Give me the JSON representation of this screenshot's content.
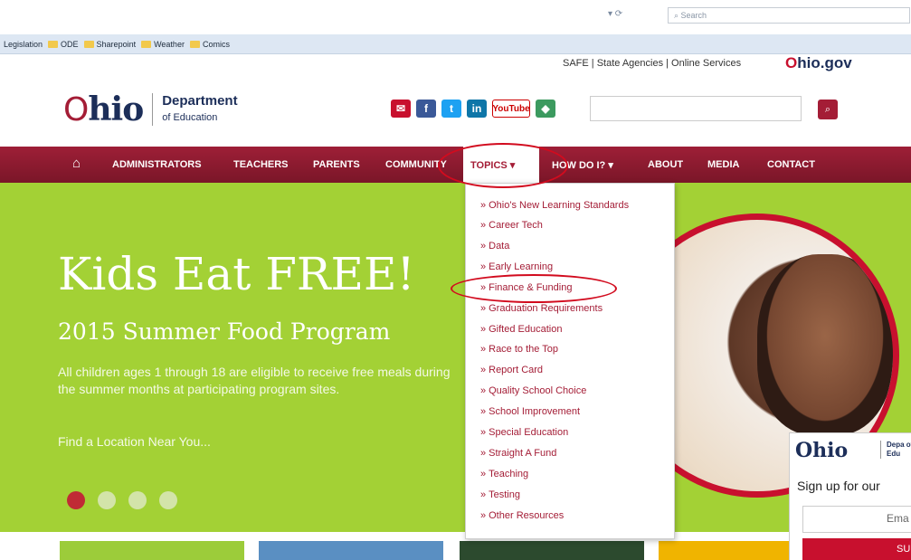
{
  "browser": {
    "refresh_icon": "refresh-icon",
    "search_placeholder": "Search",
    "bookmarks": [
      "Legislation",
      "ODE",
      "Sharepoint",
      "Weather",
      "Comics"
    ]
  },
  "header": {
    "util_links": "SAFE | State Agencies | Online Services",
    "ohio_gov_prefix": "O",
    "ohio_gov_rest": "hio.gov",
    "logo_o": "O",
    "logo_rest": "hio",
    "dept_line1": "Department",
    "dept_line2": "of Education",
    "social_icons": [
      "email-icon",
      "facebook-icon",
      "twitter-icon",
      "linkedin-icon",
      "youtube-icon",
      "rss-icon"
    ],
    "youtube_text": "YouTube"
  },
  "nav": {
    "items": [
      "ADMINISTRATORS",
      "TEACHERS",
      "PARENTS",
      "COMMUNITY",
      "TOPICS ▾",
      "HOW DO I? ▾",
      "ABOUT",
      "MEDIA",
      "CONTACT"
    ]
  },
  "hero": {
    "title": "Kids Eat FREE!",
    "subtitle": "2015 Summer Food Program",
    "description": "All children ages 1 through 18 are eligible to receive free meals during the summer months at participating program sites.",
    "link": "Find a Location Near You..."
  },
  "dropdown": {
    "items": [
      "Ohio's New Learning Standards",
      "Career Tech",
      "Data",
      "Early Learning",
      "Finance & Funding",
      "Graduation Requirements",
      "Gifted Education",
      "Race to the Top",
      "Report Card",
      "Quality School Choice",
      "School Improvement",
      "Special Education",
      "Straight A Fund",
      "Teaching",
      "Testing",
      "Other Resources"
    ]
  },
  "widget": {
    "logo": "Ohio",
    "dept": "Depa of Edu",
    "signup": "Sign up for our",
    "email_placeholder": "Ema",
    "button": "SU"
  },
  "colors": {
    "brand_red": "#a41d36",
    "hero_green": "#a3d135",
    "highlight_red": "#d20b1e",
    "navy": "#1c2e59"
  }
}
